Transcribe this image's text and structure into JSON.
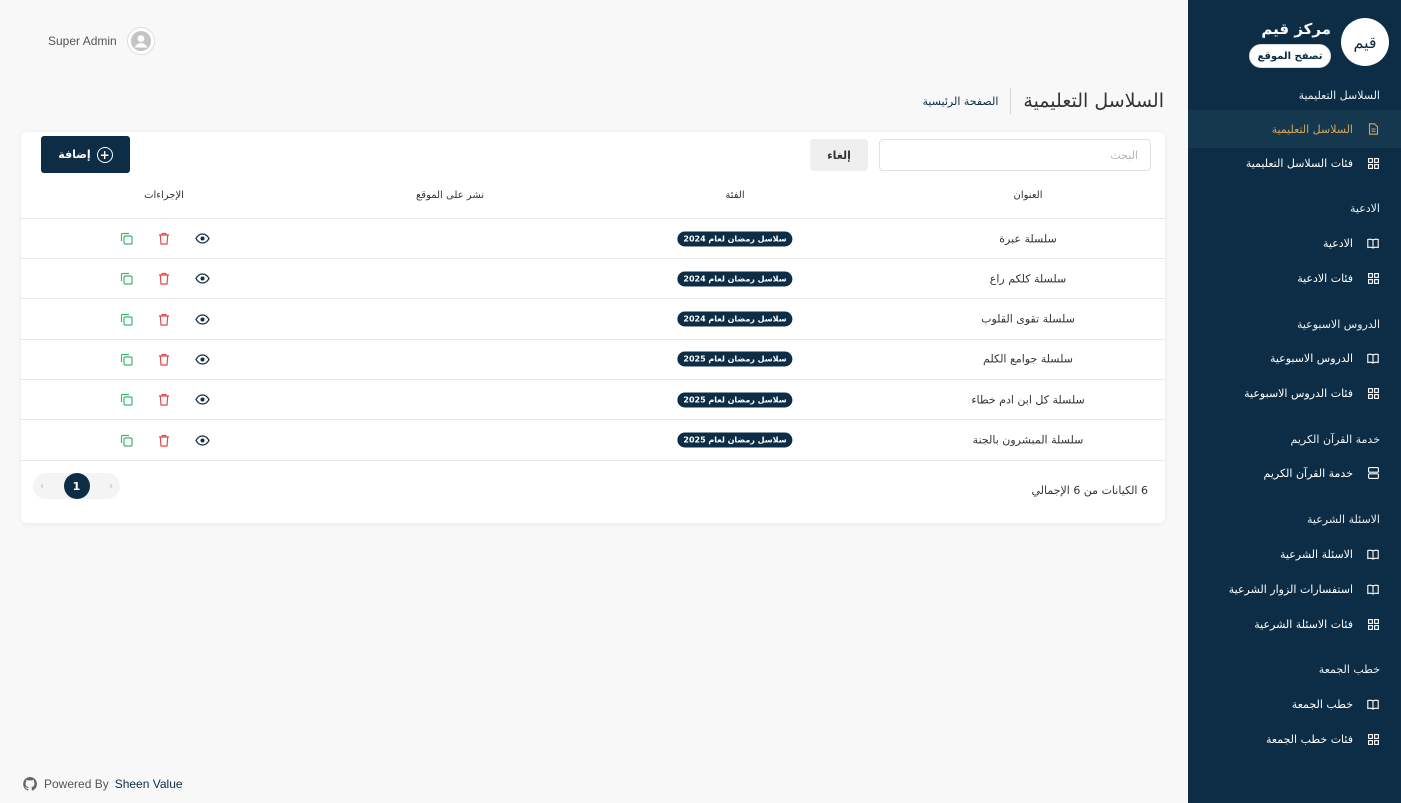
{
  "colors": {
    "primary": "#0c2d45",
    "active_text": "#d6a456",
    "delete": "#e04a4a",
    "copy": "#3cb46e"
  },
  "sidebar": {
    "brand_name": "مركز قيم",
    "browse_label": "تصفح الموقع",
    "sections": [
      {
        "title": "السلاسل التعليمية",
        "items": [
          {
            "label": "السلاسل التعليمية",
            "icon": "document-icon",
            "active": true
          },
          {
            "label": "فئات السلاسل التعليمية",
            "icon": "grid-icon"
          }
        ]
      },
      {
        "title": "الادعية",
        "items": [
          {
            "label": "الادعية",
            "icon": "book-icon"
          },
          {
            "label": "فئات الادعية",
            "icon": "grid-icon"
          }
        ]
      },
      {
        "title": "الدروس الاسبوعية",
        "items": [
          {
            "label": "الدروس الاسبوعية",
            "icon": "book-icon"
          },
          {
            "label": "فئات الدروس الاسبوعية",
            "icon": "grid-icon"
          }
        ]
      },
      {
        "title": "خدمة القرآن الكريم",
        "items": [
          {
            "label": "خدمة القرآن الكريم",
            "icon": "server-icon"
          }
        ]
      },
      {
        "title": "الاسئلة الشرعية",
        "items": [
          {
            "label": "الاسئلة الشرعية",
            "icon": "book-icon"
          },
          {
            "label": "استفسارات الزوار الشرعية",
            "icon": "book-icon"
          },
          {
            "label": "فئات الاسئلة الشرعية",
            "icon": "grid-icon"
          }
        ]
      },
      {
        "title": "خطب الجمعة",
        "items": [
          {
            "label": "خطب الجمعة",
            "icon": "book-icon"
          },
          {
            "label": "فئات خطب الجمعة",
            "icon": "grid-icon"
          }
        ]
      }
    ]
  },
  "topbar": {
    "user_name": "Super Admin"
  },
  "page": {
    "title": "السلاسل التعليمية",
    "breadcrumb": "الصفحة الرئيسية"
  },
  "toolbar": {
    "search_placeholder": "البحث",
    "cancel_label": "إلغاء",
    "add_label": "إضافة"
  },
  "table": {
    "headers": {
      "title": "العنوان",
      "category": "الفئة",
      "publish": "نشر على الموقع",
      "actions": "الإجراءات"
    },
    "rows": [
      {
        "title": "سلسلة عبرة",
        "category": "سلاسل رمضان لعام 2024",
        "published": true
      },
      {
        "title": "سلسلة كلكم راع",
        "category": "سلاسل رمضان لعام 2024",
        "published": true
      },
      {
        "title": "سلسلة تقوى القلوب",
        "category": "سلاسل رمضان لعام 2024",
        "published": true
      },
      {
        "title": "سلسلة جوامع الكلم",
        "category": "سلاسل رمضان لعام 2025",
        "published": true
      },
      {
        "title": "سلسلة كل ابن ادم خطاء",
        "category": "سلاسل رمضان لعام 2025",
        "published": true
      },
      {
        "title": "سلسلة المبشرون بالجنة",
        "category": "سلاسل رمضان لعام 2025",
        "published": true
      }
    ]
  },
  "pagination": {
    "total_text": "6 الكيانات من 6 الإجمالي",
    "current_page": "1",
    "prev": "‹",
    "next": "›"
  },
  "footer": {
    "powered_by": "Powered By",
    "brand": "Sheen Value"
  }
}
